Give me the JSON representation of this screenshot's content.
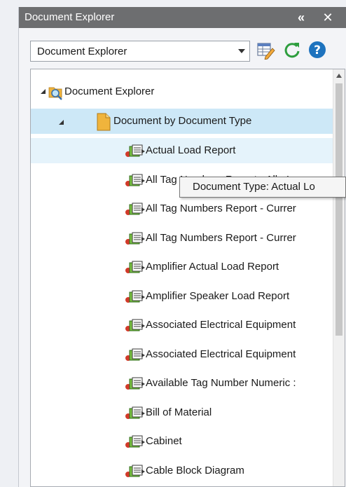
{
  "panel": {
    "title": "Document Explorer",
    "collapse_glyph": "«",
    "close_glyph": "✕"
  },
  "toolbar": {
    "combo_value": "Document Explorer",
    "icons": [
      "grid-edit-icon",
      "refresh-icon",
      "help-icon"
    ],
    "help_glyph": "?"
  },
  "tree": {
    "root_label": "Document Explorer",
    "group_label": "Document by Document Type",
    "items": [
      "Actual Load Report",
      "All Tag Numbers Report - All <L",
      "All Tag Numbers Report - Currer",
      "All Tag Numbers Report - Currer",
      "Amplifier Actual Load Report",
      "Amplifier Speaker Load Report",
      "Associated Electrical Equipment",
      "Associated Electrical Equipment",
      "Available Tag Number Numeric :",
      "Bill of Material",
      "Cabinet",
      "Cable Block Diagram"
    ]
  },
  "tooltip": {
    "text": "Document Type: Actual Lo"
  },
  "colors": {
    "titlebar": "#6d6e70",
    "selection": "#cde8f7",
    "hover": "#e5f3fb",
    "folder": "#f0b43c",
    "refresh": "#2e9e3e",
    "help": "#1e73be"
  }
}
